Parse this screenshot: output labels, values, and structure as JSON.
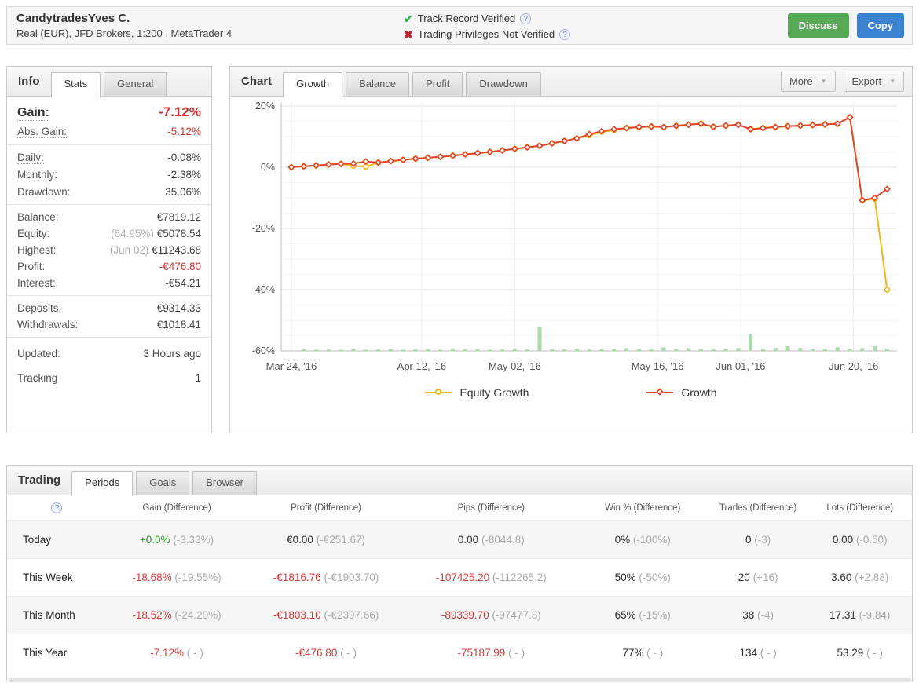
{
  "header": {
    "name": "CandytradesYves C.",
    "subtitle_pre": "Real (EUR), ",
    "broker": "JFD Brokers",
    "subtitle_post": ", 1:200 , MetaTrader 4",
    "track_record": "Track Record Verified",
    "privileges": "Trading Privileges Not Verified",
    "discuss_label": "Discuss",
    "copy_label": "Copy",
    "discuss_color": "#57a957",
    "copy_color": "#3b82d0"
  },
  "info": {
    "title": "Info",
    "tabs": [
      "Stats",
      "General"
    ],
    "active_tab": "Stats",
    "groups": [
      [
        {
          "label": "Gain:",
          "value": "-7.12%",
          "style": "gain-big",
          "dotted": true
        },
        {
          "label": "Abs. Gain:",
          "value": "-5.12%",
          "style": "red",
          "dotted": true
        }
      ],
      [
        {
          "label": "Daily:",
          "value": "-0.08%",
          "dotted": true
        },
        {
          "label": "Monthly:",
          "value": "-2.38%",
          "dotted": true
        },
        {
          "label": "Drawdown:",
          "value": "35.06%"
        }
      ],
      [
        {
          "label": "Balance:",
          "value": "€7819.12"
        },
        {
          "label": "Equity:",
          "prefix": "(64.95%)",
          "value": "€5078.54"
        },
        {
          "label": "Highest:",
          "prefix": "(Jun 02)",
          "value": "€11243.68"
        },
        {
          "label": "Profit:",
          "value": "-€476.80",
          "style": "red"
        },
        {
          "label": "Interest:",
          "value": "-€54.21"
        }
      ],
      [
        {
          "label": "Deposits:",
          "value": "€9314.33"
        },
        {
          "label": "Withdrawals:",
          "value": "€1018.41"
        }
      ],
      [
        {
          "label": "Updated:",
          "value": "3 Hours ago",
          "tall": true
        },
        {
          "label": "Tracking",
          "value": "1",
          "tall": true
        }
      ]
    ]
  },
  "chart": {
    "title": "Chart",
    "tabs": [
      "Growth",
      "Balance",
      "Profit",
      "Drawdown"
    ],
    "active_tab": "Growth",
    "more_label": "More",
    "export_label": "Export"
  },
  "chart_data": {
    "type": "line",
    "title": "",
    "xlabel": "",
    "ylabel": "",
    "ylim": [
      -62,
      22
    ],
    "grid": true,
    "legend_position": "bottom",
    "y_ticks": [
      {
        "v": 20,
        "label": "20%"
      },
      {
        "v": 0,
        "label": "0%"
      },
      {
        "v": -20,
        "label": "-20%"
      },
      {
        "v": -40,
        "label": "-40%"
      },
      {
        "v": -60,
        "label": "-60%"
      }
    ],
    "x_ticks": [
      {
        "pos": 0,
        "label": "Mar 24, '16"
      },
      {
        "pos": 10.5,
        "label": "Apr 12, '16"
      },
      {
        "pos": 18,
        "label": "May 02, '16"
      },
      {
        "pos": 29.5,
        "label": "May 16, '16"
      },
      {
        "pos": 36.2,
        "label": "Jun 01, '16"
      },
      {
        "pos": 45.3,
        "label": "Jun 20, '16"
      }
    ],
    "series": [
      {
        "name": "Equity Growth",
        "color": "#f0b517",
        "marker": "circle",
        "values": [
          0.0,
          0.3,
          0.6,
          0.9,
          1.1,
          0.5,
          0.2,
          1.5,
          2.0,
          2.4,
          2.8,
          3.1,
          3.4,
          3.8,
          4.2,
          4.6,
          5.0,
          5.5,
          6.0,
          6.5,
          7.0,
          7.8,
          8.6,
          9.4,
          10.4,
          11.5,
          12.1,
          12.8,
          13.1,
          13.3,
          13.1,
          13.5,
          13.9,
          14.2,
          13.2,
          13.6,
          13.9,
          12.4,
          12.8,
          13.1,
          13.4,
          13.6,
          13.8,
          14.0,
          14.2,
          16.3,
          -10.8,
          -10.3,
          -40.0
        ]
      },
      {
        "name": "Growth",
        "color": "#e0452c",
        "marker": "diamond",
        "values": [
          0.0,
          0.3,
          0.6,
          0.9,
          1.1,
          1.2,
          1.9,
          1.5,
          2.0,
          2.4,
          2.8,
          3.1,
          3.4,
          3.8,
          4.2,
          4.6,
          5.0,
          5.5,
          6.0,
          6.5,
          7.0,
          7.8,
          8.6,
          9.4,
          10.8,
          11.8,
          12.4,
          12.8,
          13.1,
          13.3,
          13.1,
          13.5,
          13.9,
          14.2,
          13.2,
          13.6,
          13.9,
          12.4,
          12.8,
          13.1,
          13.4,
          13.6,
          13.8,
          14.0,
          14.2,
          16.3,
          -10.8,
          -10.0,
          -7.1
        ]
      }
    ],
    "bars": {
      "color": "#abd9ab",
      "baseline": -60,
      "values": [
        0.0,
        0.6,
        0.4,
        0.5,
        0.4,
        0.7,
        0.4,
        0.5,
        0.6,
        0.4,
        0.5,
        0.6,
        0.4,
        0.7,
        0.5,
        0.6,
        0.4,
        0.5,
        0.7,
        0.5,
        8.0,
        0.6,
        0.5,
        0.7,
        0.5,
        0.8,
        0.6,
        0.9,
        0.6,
        0.8,
        1.2,
        0.7,
        0.9,
        0.6,
        0.8,
        0.7,
        0.9,
        5.5,
        0.8,
        1.0,
        1.5,
        1.0,
        0.7,
        0.8,
        1.2,
        0.7,
        0.9,
        1.5,
        0.8
      ]
    }
  },
  "trading": {
    "title": "Trading",
    "tabs": [
      "Periods",
      "Goals",
      "Browser"
    ],
    "active_tab": "Periods",
    "columns": [
      "Gain (Difference)",
      "Profit (Difference)",
      "Pips (Difference)",
      "Win % (Difference)",
      "Trades (Difference)",
      "Lots (Difference)"
    ],
    "rows": [
      {
        "label": "Today",
        "cells": [
          {
            "v": "+0.0%",
            "d": "(-3.33%)",
            "c": "pos"
          },
          {
            "v": "€0.00",
            "d": "(-€251.67)",
            "c": "neutral"
          },
          {
            "v": "0.00",
            "d": "(-8044.8)",
            "c": "neutral"
          },
          {
            "v": "0%",
            "d": "(-100%)",
            "c": "neutral"
          },
          {
            "v": "0",
            "d": "(-3)",
            "c": "neutral"
          },
          {
            "v": "0.00",
            "d": "(-0.50)",
            "c": "neutral"
          }
        ]
      },
      {
        "label": "This Week",
        "cells": [
          {
            "v": "-18.68%",
            "d": "(-19.55%)",
            "c": "neg"
          },
          {
            "v": "-€1816.76",
            "d": "(-€1903.70)",
            "c": "neg"
          },
          {
            "v": "-107425.20",
            "d": "(-112265.2)",
            "c": "neg"
          },
          {
            "v": "50%",
            "d": "(-50%)",
            "c": "neutral"
          },
          {
            "v": "20",
            "d": "(+16)",
            "c": "neutral"
          },
          {
            "v": "3.60",
            "d": "(+2.88)",
            "c": "neutral"
          }
        ]
      },
      {
        "label": "This Month",
        "cells": [
          {
            "v": "-18.52%",
            "d": "(-24.20%)",
            "c": "neg"
          },
          {
            "v": "-€1803.10",
            "d": "(-€2397.66)",
            "c": "neg"
          },
          {
            "v": "-89339.70",
            "d": "(-97477.8)",
            "c": "neg"
          },
          {
            "v": "65%",
            "d": "(-15%)",
            "c": "neutral"
          },
          {
            "v": "38",
            "d": "(-4)",
            "c": "neutral"
          },
          {
            "v": "17.31",
            "d": "(-9.84)",
            "c": "neutral"
          }
        ]
      },
      {
        "label": "This Year",
        "cells": [
          {
            "v": "-7.12%",
            "d": "( - )",
            "c": "neg"
          },
          {
            "v": "-€476.80",
            "d": "( - )",
            "c": "neg"
          },
          {
            "v": "-75187.99",
            "d": "( - )",
            "c": "neg"
          },
          {
            "v": "77%",
            "d": "( - )",
            "c": "neutral"
          },
          {
            "v": "134",
            "d": "( - )",
            "c": "neutral"
          },
          {
            "v": "53.29",
            "d": "( - )",
            "c": "neutral"
          }
        ]
      }
    ]
  }
}
